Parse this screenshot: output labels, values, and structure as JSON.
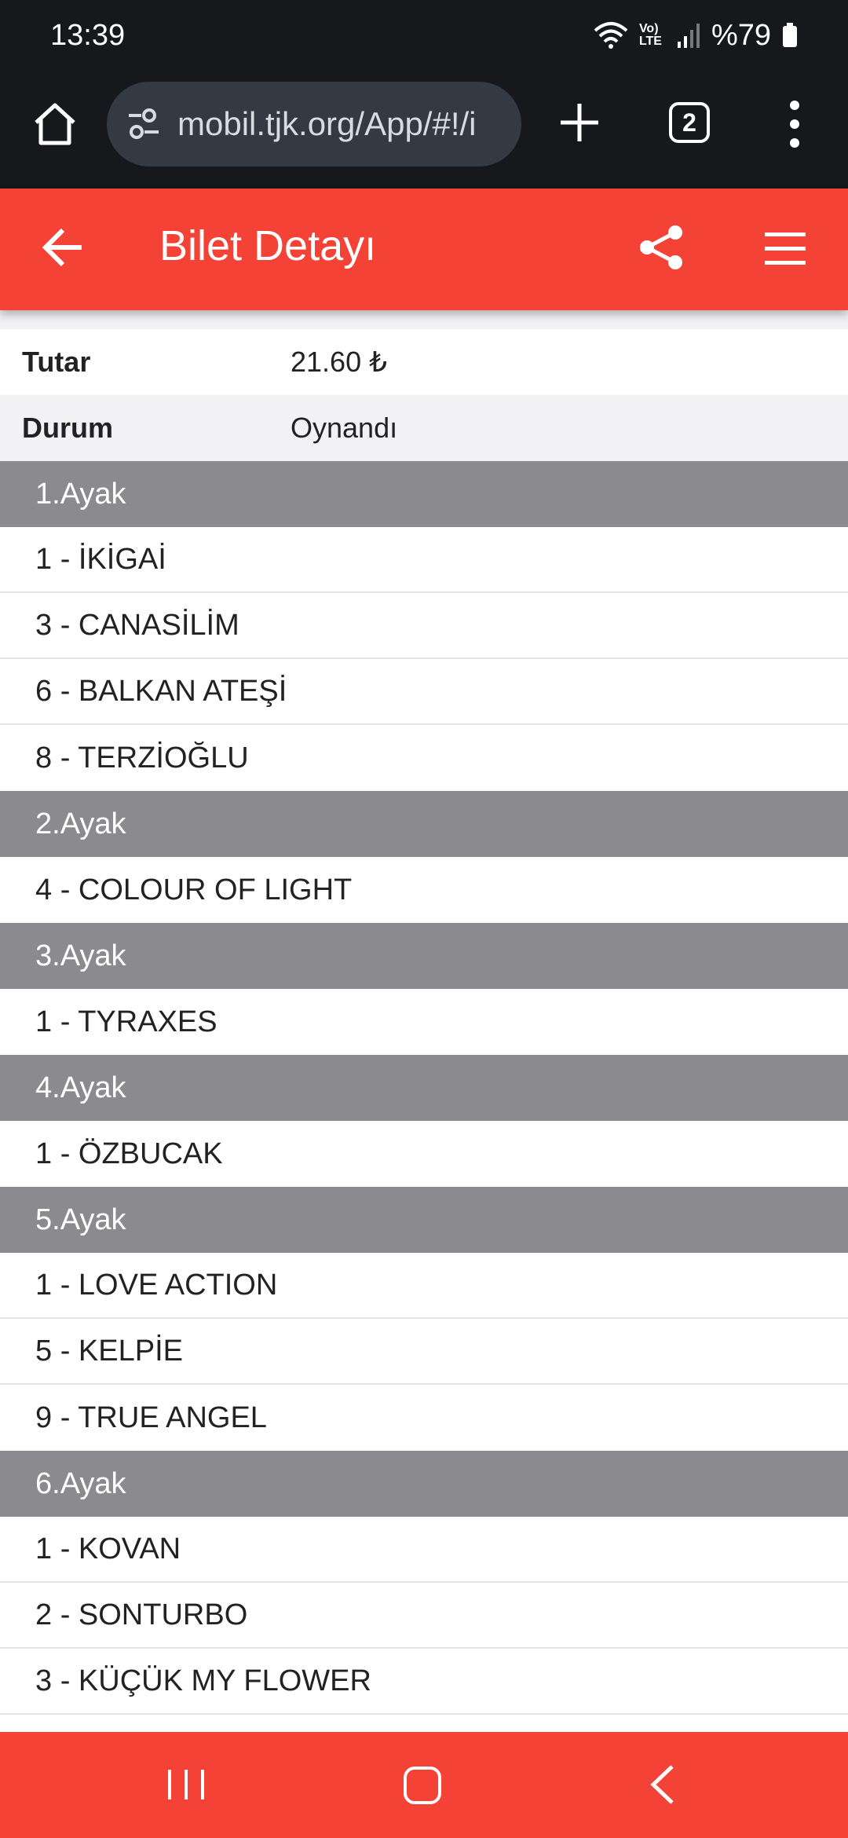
{
  "status_bar": {
    "time": "13:39",
    "network_label": "Vo) LTE",
    "battery": "%79"
  },
  "browser": {
    "url": "mobil.tjk.org/App/#!/i",
    "tab_count": "2"
  },
  "header": {
    "title": "Bilet Detayı"
  },
  "info_rows": [
    {
      "label": "Tutar",
      "value": "21.60 ₺"
    },
    {
      "label": "Durum",
      "value": "Oynandı"
    }
  ],
  "legs": [
    {
      "title": "1.Ayak",
      "horses": [
        "1 - İKİGAİ",
        "3 - CANASİLİM",
        "6 - BALKAN ATEŞİ",
        "8 - TERZİOĞLU"
      ]
    },
    {
      "title": "2.Ayak",
      "horses": [
        "4 - COLOUR OF LIGHT"
      ]
    },
    {
      "title": "3.Ayak",
      "horses": [
        "1 - TYRAXES"
      ]
    },
    {
      "title": "4.Ayak",
      "horses": [
        "1 - ÖZBUCAK"
      ]
    },
    {
      "title": "5.Ayak",
      "horses": [
        "1 - LOVE ACTION",
        "5 - KELPİE",
        "9 - TRUE ANGEL"
      ]
    },
    {
      "title": "6.Ayak",
      "horses": [
        "1 - KOVAN",
        "2 - SONTURBO",
        "3 - KÜÇÜK MY FLOWER"
      ]
    }
  ],
  "icons": {
    "home": "home-icon",
    "tune": "tune-icon",
    "add": "plus-icon",
    "more": "more-vert-icon",
    "back": "arrow-back-icon",
    "share": "share-icon",
    "menu": "hamburger-menu-icon"
  },
  "colors": {
    "accent": "#f44336",
    "leg_header": "#8b8a8e",
    "system_bar": "#16181c"
  }
}
